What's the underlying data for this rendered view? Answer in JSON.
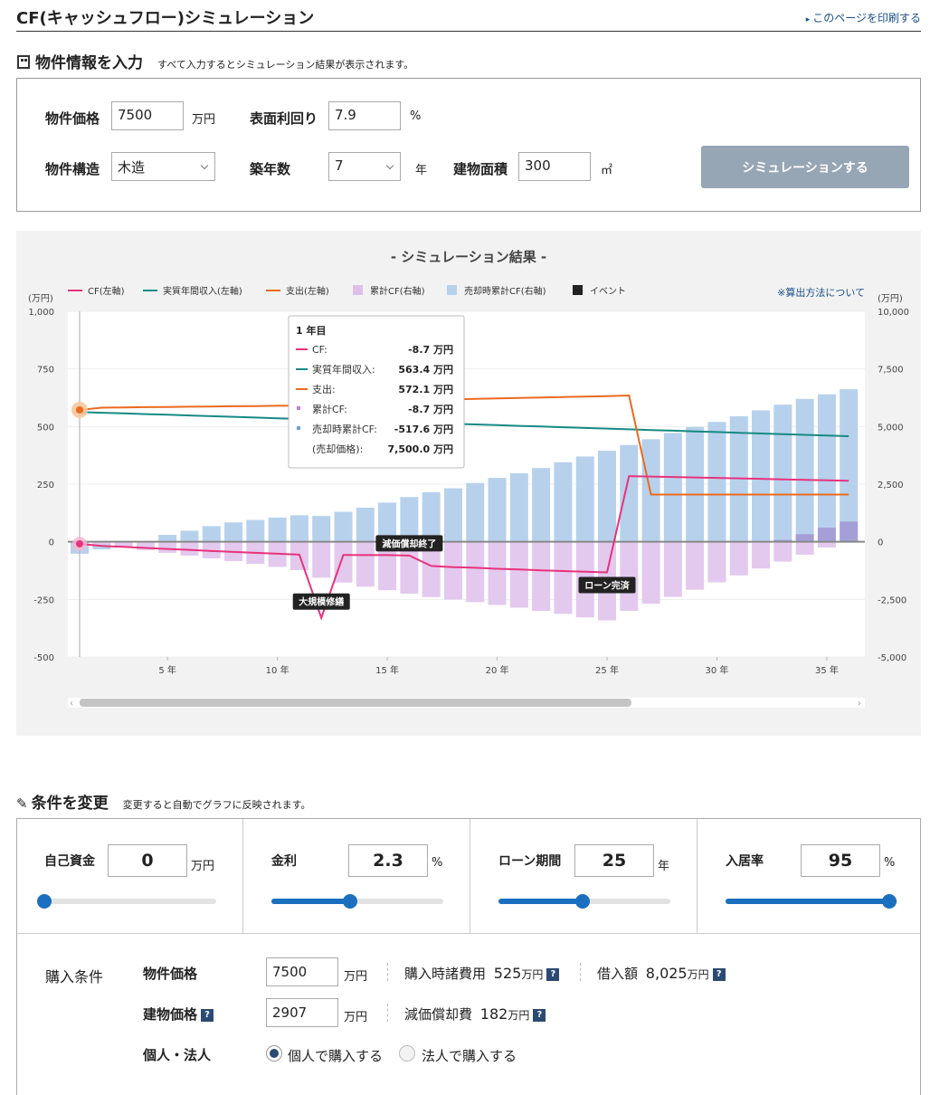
{
  "header": {
    "title": "CF(キャッシュフロー)シミュレーション",
    "print_link": "このページを印刷する"
  },
  "property": {
    "heading": "物件情報を入力",
    "note": "すべて入力するとシミュレーション結果が表示されます。",
    "price_label": "物件価格",
    "price_value": "7500",
    "price_unit": "万円",
    "yield_label": "表面利回り",
    "yield_value": "7.9",
    "yield_unit": "%",
    "structure_label": "物件構造",
    "structure_value": "木造",
    "age_label": "築年数",
    "age_value": "7",
    "age_unit": "年",
    "area_label": "建物面積",
    "area_value": "300",
    "area_unit": "㎡",
    "simulate_button": "シミュレーションする"
  },
  "result": {
    "title": "- シミュレーション結果 -",
    "method_link": "※算出方法について"
  },
  "chart_data": {
    "type": "bar+line",
    "legend": [
      {
        "name": "CF(左軸)",
        "color": "#e8327d",
        "kind": "line"
      },
      {
        "name": "実質年間収入(左軸)",
        "color": "#168a83",
        "kind": "line"
      },
      {
        "name": "支出(左軸)",
        "color": "#ea6a1f",
        "kind": "line"
      },
      {
        "name": "累計CF(右軸)",
        "color": "#dcc0ea",
        "kind": "box"
      },
      {
        "name": "売却時累計CF(右軸)",
        "color": "#b7d1ec",
        "kind": "box"
      },
      {
        "name": "イベント",
        "color": "#222222",
        "kind": "box"
      }
    ],
    "left_unit": "(万円)",
    "right_unit": "(万円)",
    "y_left_ticks": [
      "1,000",
      "750",
      "500",
      "250",
      "0",
      "-250",
      "-500"
    ],
    "y_right_ticks": [
      "10,000",
      "7,500",
      "5,000",
      "2,500",
      "0",
      "-2,500",
      "-5,000"
    ],
    "y_left_range": [
      -500,
      1000
    ],
    "y_right_range": [
      -5000,
      10000
    ],
    "x_ticks": [
      {
        "year": 5,
        "label": "5 年"
      },
      {
        "year": 10,
        "label": "10 年"
      },
      {
        "year": 15,
        "label": "15 年"
      },
      {
        "year": 20,
        "label": "20 年"
      },
      {
        "year": 25,
        "label": "25 年"
      },
      {
        "year": 30,
        "label": "30 年"
      },
      {
        "year": 35,
        "label": "35 年"
      }
    ],
    "years": [
      1,
      2,
      3,
      4,
      5,
      6,
      7,
      8,
      9,
      10,
      11,
      12,
      13,
      14,
      15,
      16,
      17,
      18,
      19,
      20,
      21,
      22,
      23,
      24,
      25,
      26,
      27,
      28,
      29,
      30,
      31,
      32,
      33,
      34,
      35,
      36
    ],
    "sale_cum_cf": [
      -518,
      -330,
      -140,
      -90,
      300,
      480,
      680,
      840,
      950,
      1050,
      1150,
      1120,
      1300,
      1480,
      1700,
      1940,
      2150,
      2320,
      2550,
      2770,
      2970,
      3200,
      3450,
      3700,
      3950,
      4200,
      4450,
      4720,
      4980,
      5200,
      5450,
      5700,
      5950,
      6200,
      6400,
      6620
    ],
    "cum_cf": [
      -9,
      -120,
      -240,
      -360,
      -480,
      -600,
      -720,
      -840,
      -960,
      -1090,
      -1230,
      -1560,
      -1770,
      -1950,
      -2100,
      -2250,
      -2400,
      -2510,
      -2620,
      -2740,
      -2860,
      -3000,
      -3130,
      -3280,
      -3410,
      -3000,
      -2690,
      -2390,
      -2080,
      -1760,
      -1460,
      -1160,
      -860,
      -560,
      -250,
      60
    ],
    "cum_cf_pos": [
      0,
      0,
      0,
      0,
      0,
      0,
      0,
      0,
      0,
      0,
      0,
      0,
      0,
      0,
      0,
      0,
      0,
      0,
      0,
      0,
      0,
      0,
      0,
      0,
      0,
      0,
      0,
      0,
      0,
      0,
      0,
      0,
      80,
      330,
      610,
      880
    ],
    "cf": [
      -9,
      -18,
      -22,
      -27,
      -31,
      -35,
      -40,
      -44,
      -48,
      -52,
      -56,
      -330,
      -57,
      -58,
      -58,
      -60,
      -105,
      -110,
      -113,
      -117,
      -120,
      -124,
      -127,
      -130,
      -133,
      285,
      283,
      281,
      279,
      277,
      275,
      273,
      271,
      269,
      267,
      265
    ],
    "income": [
      563,
      560,
      557,
      554,
      551,
      548,
      545,
      542,
      539,
      536,
      533,
      530,
      527,
      524,
      521,
      518,
      515,
      512,
      509,
      506,
      503,
      500,
      497,
      494,
      491,
      488,
      485,
      482,
      479,
      476,
      473,
      470,
      467,
      464,
      461,
      458
    ],
    "expense": [
      572,
      582,
      583,
      584,
      585,
      586,
      587,
      588,
      589,
      590,
      591,
      592,
      593,
      594,
      595,
      596,
      615,
      618,
      620,
      622,
      624,
      626,
      628,
      630,
      632,
      635,
      205,
      205,
      205,
      205,
      205,
      205,
      205,
      205,
      205,
      205
    ],
    "events": [
      {
        "year": 12,
        "label": "大規模修繕",
        "value": -330
      },
      {
        "year": 16,
        "label": "減価償却終了",
        "value": -58
      },
      {
        "year": 25,
        "label": "ローン完済",
        "value": -133
      }
    ],
    "tooltip": {
      "title": "1 年目",
      "rows": [
        {
          "name": "CF:",
          "value": "-8.7 万円",
          "color": "#e8327d",
          "kind": "line"
        },
        {
          "name": "実質年間収入:",
          "value": "563.4 万円",
          "color": "#168a83",
          "kind": "line"
        },
        {
          "name": "支出:",
          "value": "572.1 万円",
          "color": "#ea6a1f",
          "kind": "line"
        },
        {
          "name": "累計CF:",
          "value": "-8.7 万円",
          "color": "#c07fd6",
          "kind": "dot"
        },
        {
          "name": "売却時累計CF:",
          "value": "-517.6 万円",
          "color": "#6d9fd6",
          "kind": "dot"
        },
        {
          "name": "(売却価格):",
          "value": "7,500.0 万円",
          "color": "",
          "kind": "none"
        }
      ]
    }
  },
  "conditions": {
    "heading": "条件を変更",
    "note": "変更すると自動でグラフに反映されます。",
    "sliders": [
      {
        "label": "自己資金",
        "value": "0",
        "unit": "万円",
        "ratio": 0.0
      },
      {
        "label": "金利",
        "value": "2.3",
        "unit": "%",
        "ratio": 0.46
      },
      {
        "label": "ローン期間",
        "value": "25",
        "unit": "年",
        "ratio": 0.49
      },
      {
        "label": "入居率",
        "value": "95",
        "unit": "%",
        "ratio": 0.95
      }
    ],
    "purchase": {
      "section_label": "購入条件",
      "price_label": "物件価格",
      "price_value": "7500",
      "price_unit": "万円",
      "fees_label": "購入時諸費用",
      "fees_value": "525",
      "fees_unit": "万円",
      "loan_label": "借入額",
      "loan_value": "8,025",
      "loan_unit": "万円",
      "building_label": "建物価格",
      "building_value": "2907",
      "building_unit": "万円",
      "depr_label": "減価償却費",
      "depr_value": "182",
      "depr_unit": "万円",
      "owner_label": "個人・法人",
      "individual": "個人で購入する",
      "corporate": "法人で購入する",
      "help": "?"
    }
  }
}
